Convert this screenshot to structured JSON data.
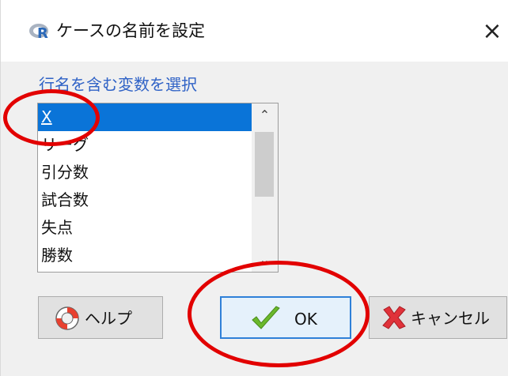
{
  "dialog": {
    "title": "ケースの名前を設定",
    "close_glyph": "×",
    "group_label": "行名を含む変数を選択",
    "list_items": [
      "X",
      "リーグ",
      "引分数",
      "試合数",
      "失点",
      "勝数"
    ],
    "selected_index": 0,
    "scroll_up_glyph": "⌃",
    "scroll_down_glyph": "⌄",
    "buttons": {
      "help": "ヘルプ",
      "ok": "OK",
      "cancel": "キャンセル"
    }
  },
  "colors": {
    "selection": "#0a74d8",
    "label_blue": "#2f62c6",
    "annotation_red": "#e20000",
    "ok_check_green": "#6bb82b",
    "cancel_x_red": "#e0323a"
  },
  "icons": {
    "title": "r-logo-icon",
    "help": "lifebuoy-icon",
    "ok": "checkmark-icon",
    "cancel": "x-mark-icon"
  }
}
